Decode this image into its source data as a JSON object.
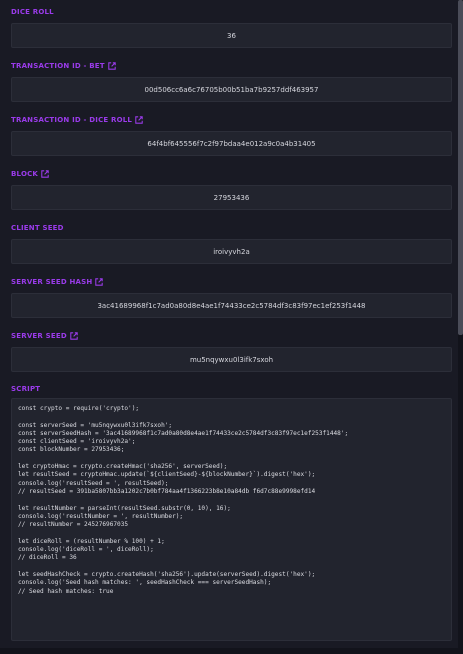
{
  "fields": [
    {
      "label": "DICE ROLL",
      "link": false,
      "value": "36"
    },
    {
      "label": "TRANSACTION ID - BET",
      "link": true,
      "value": "00d506cc6a6c76705b00b51ba7b9257ddf463957"
    },
    {
      "label": "TRANSACTION ID - DICE ROLL",
      "link": true,
      "value": "64f4bf645556f7c2f97bdaa4e012a9c0a4b31405"
    },
    {
      "label": "BLOCK",
      "link": true,
      "value": "27953436"
    },
    {
      "label": "CLIENT SEED",
      "link": false,
      "value": "iroivyvh2a"
    },
    {
      "label": "SERVER SEED HASH",
      "link": true,
      "value": "3ac41689968f1c7ad0a80d8e4ae1f74433ce2c5784df3c83f97ec1ef253f1448"
    },
    {
      "label": "SERVER SEED",
      "link": true,
      "value": "mu5nqywxu0l3ifk7sxoh"
    }
  ],
  "script": {
    "label": "SCRIPT",
    "lines": [
      "const crypto = require('crypto');",
      "",
      "const serverSeed = 'mu5nqywxu0l3ifk7sxoh';",
      "const serverSeedHash = '3ac41689968f1c7ad0a80d8e4ae1f74433ce2c5784df3c83f97ec1ef253f1448';",
      "const clientSeed = 'iroivyvh2a';",
      "const blockNumber = 27953436;",
      "",
      "let cryptoHmac = crypto.createHmac('sha256', serverSeed);",
      "let resultSeed = cryptoHmac.update(`${clientSeed}-${blockNumber}`).digest('hex');",
      "console.log('resultSeed = ', resultSeed);",
      "// resultSeed = 391ba5807bb3a1202c7b0bf784aa4f1366223b8e10a84db f6d7c88e9998efd14",
      "",
      "let resultNumber = parseInt(resultSeed.substr(0, 10), 16);",
      "console.log('resultNumber = ', resultNumber);",
      "// resultNumber = 245276967035",
      "",
      "let diceRoll = (resultNumber % 100) + 1;",
      "console.log('diceRoll = ', diceRoll);",
      "// diceRoll = 36",
      "",
      "let seedHashCheck = crypto.createHash('sha256').update(serverSeed).digest('hex');",
      "console.log('Seed hash matches: ', seedHashCheck === serverSeedHash);",
      "// Seed hash matches: true"
    ]
  },
  "colors": {
    "accent": "#9a3bea",
    "background": "#191a24",
    "box": "#22242e"
  }
}
